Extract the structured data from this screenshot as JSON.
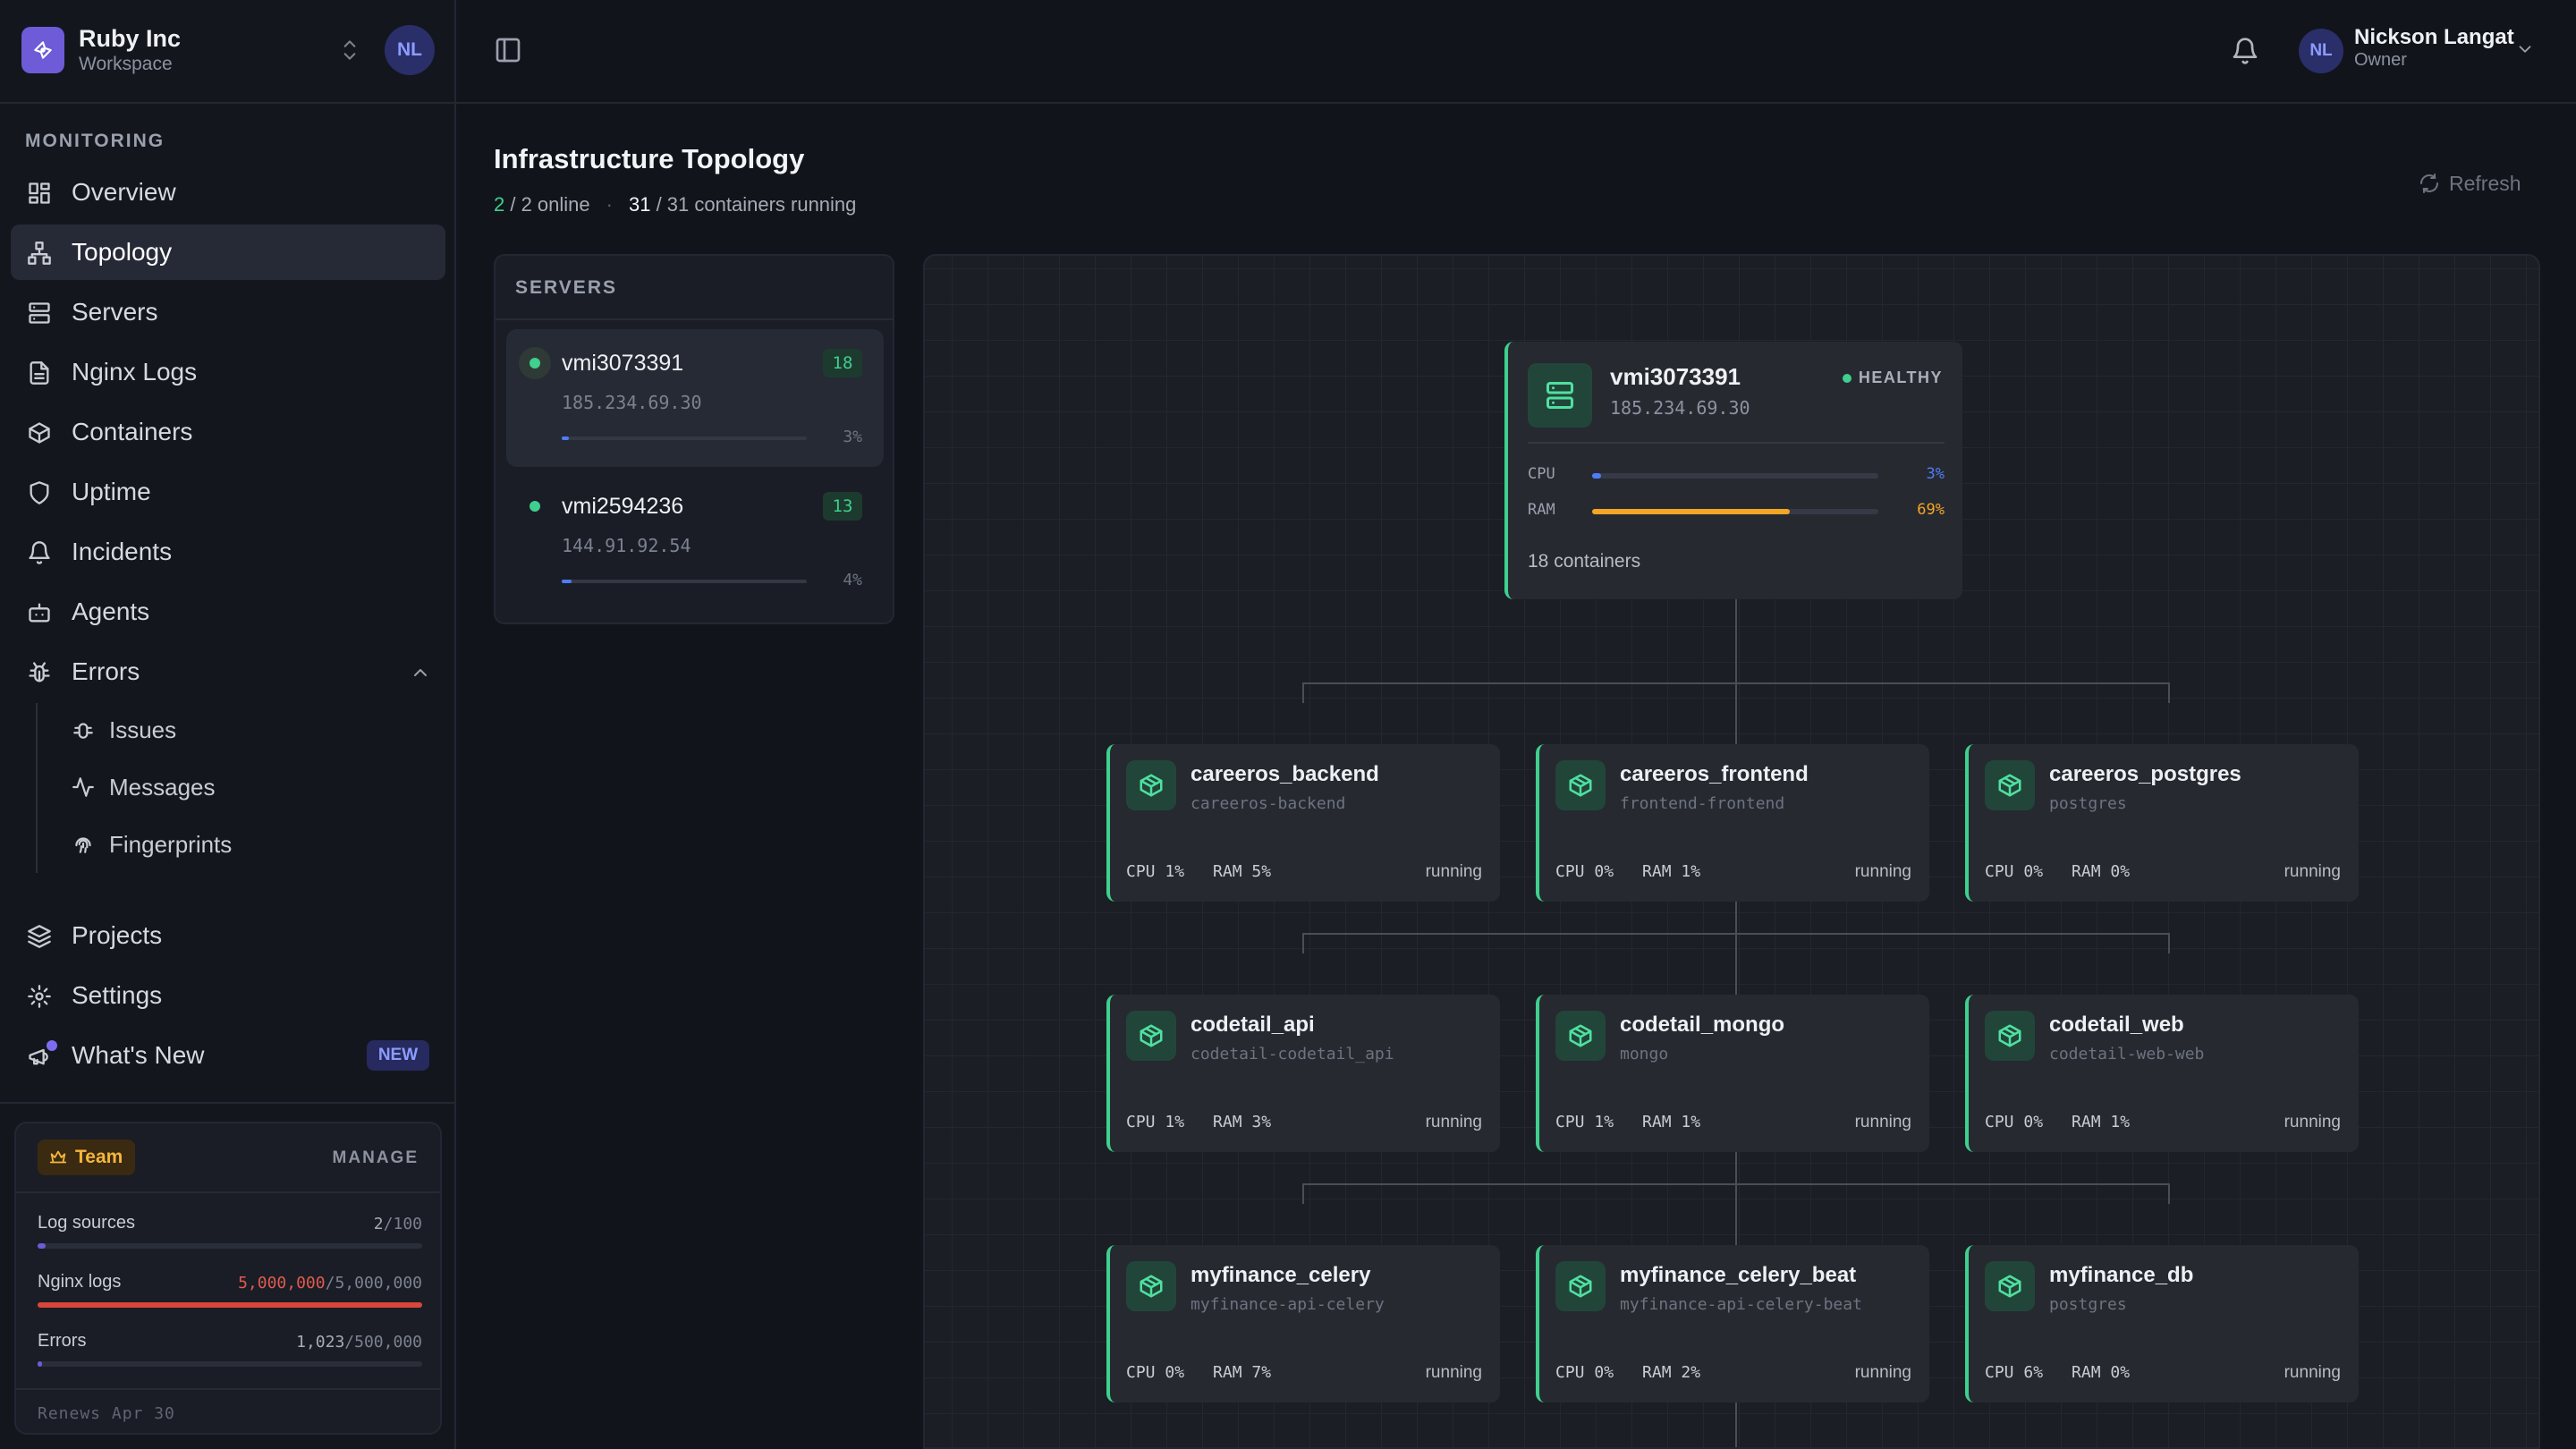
{
  "workspace": {
    "name": "Ruby Inc",
    "subtitle": "Workspace",
    "avatar": "NL"
  },
  "nav": {
    "heading": "MONITORING",
    "items": [
      {
        "label": "Overview",
        "icon": "grid-icon"
      },
      {
        "label": "Topology",
        "icon": "topology-icon",
        "active": true
      },
      {
        "label": "Servers",
        "icon": "server-icon"
      },
      {
        "label": "Nginx Logs",
        "icon": "file-icon"
      },
      {
        "label": "Containers",
        "icon": "box-icon"
      },
      {
        "label": "Uptime",
        "icon": "shield-icon"
      },
      {
        "label": "Incidents",
        "icon": "bell-icon"
      },
      {
        "label": "Agents",
        "icon": "bot-icon"
      },
      {
        "label": "Errors",
        "icon": "bug-icon",
        "expanded": true
      }
    ],
    "error_children": [
      {
        "label": "Issues",
        "icon": "bug-icon"
      },
      {
        "label": "Messages",
        "icon": "activity-icon"
      },
      {
        "label": "Fingerprints",
        "icon": "fingerprint-icon"
      }
    ],
    "bottom": [
      {
        "label": "Projects",
        "icon": "layers-icon"
      },
      {
        "label": "Settings",
        "icon": "gear-icon"
      },
      {
        "label": "What's New",
        "icon": "megaphone-icon",
        "badge": "NEW"
      }
    ]
  },
  "plan": {
    "badge": "Team",
    "manage": "MANAGE",
    "quotas": [
      {
        "label": "Log sources",
        "used": "2",
        "limit": "/100",
        "fraction": 0.02,
        "color": "#6d5bd8",
        "used_color": "#a6abb6"
      },
      {
        "label": "Nginx logs",
        "used": "5,000,000",
        "limit": "/5,000,000",
        "fraction": 1.0,
        "color": "#d9463b",
        "used_color": "#e05a4f"
      },
      {
        "label": "Errors",
        "used": "1,023",
        "limit": "/500,000",
        "fraction": 0.002,
        "color": "#6d5bd8",
        "used_color": "#a6abb6"
      }
    ],
    "renews": "Renews Apr 30"
  },
  "user": {
    "name": "Nickson Langat",
    "role": "Owner",
    "avatar": "NL"
  },
  "page": {
    "title": "Infrastructure Topology",
    "online_count": "2",
    "online_rest": " / 2 online",
    "running_count": "31",
    "running_rest": " / 31 containers running",
    "refresh": "Refresh"
  },
  "servers_panel": {
    "title": "SERVERS",
    "items": [
      {
        "name": "vmi3073391",
        "ip": "185.234.69.30",
        "count": "18",
        "cpu": "3%",
        "cpu_fraction": 0.03,
        "active": true
      },
      {
        "name": "vmi2594236",
        "ip": "144.91.92.54",
        "count": "13",
        "cpu": "4%",
        "cpu_fraction": 0.04,
        "active": false
      }
    ]
  },
  "topology": {
    "root": {
      "name": "vmi3073391",
      "ip": "185.234.69.30",
      "status": "HEALTHY",
      "cpu_label": "CPU",
      "cpu": "3%",
      "cpu_fraction": 0.03,
      "cpu_color": "#4f7cf6",
      "ram_label": "RAM",
      "ram": "69%",
      "ram_fraction": 0.69,
      "ram_color": "#f5a524",
      "containers": "18 containers"
    },
    "containers": [
      {
        "name": "careeros_backend",
        "image": "careeros-backend",
        "cpu": "1%",
        "ram": "5%",
        "state": "running"
      },
      {
        "name": "careeros_frontend",
        "image": "frontend-frontend",
        "cpu": "0%",
        "ram": "1%",
        "state": "running"
      },
      {
        "name": "careeros_postgres",
        "image": "postgres",
        "cpu": "0%",
        "ram": "0%",
        "state": "running"
      },
      {
        "name": "codetail_api",
        "image": "codetail-codetail_api",
        "cpu": "1%",
        "ram": "3%",
        "state": "running"
      },
      {
        "name": "codetail_mongo",
        "image": "mongo",
        "cpu": "1%",
        "ram": "1%",
        "state": "running"
      },
      {
        "name": "codetail_web",
        "image": "codetail-web-web",
        "cpu": "0%",
        "ram": "1%",
        "state": "running"
      },
      {
        "name": "myfinance_celery",
        "image": "myfinance-api-celery",
        "cpu": "0%",
        "ram": "7%",
        "state": "running"
      },
      {
        "name": "myfinance_celery_beat",
        "image": "myfinance-api-celery-beat",
        "cpu": "0%",
        "ram": "2%",
        "state": "running"
      },
      {
        "name": "myfinance_db",
        "image": "postgres",
        "cpu": "6%",
        "ram": "0%",
        "state": "running"
      }
    ]
  }
}
